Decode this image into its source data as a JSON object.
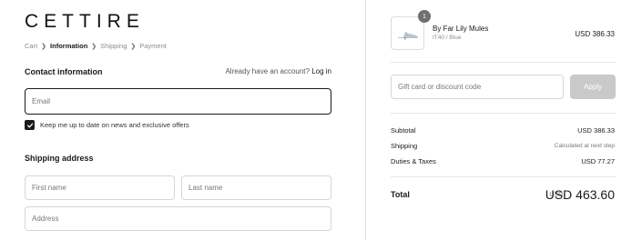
{
  "brand": {
    "logo_text": "CETTIRE"
  },
  "breadcrumb": {
    "items": [
      "Cart",
      "Information",
      "Shipping",
      "Payment"
    ]
  },
  "contact": {
    "title": "Contact information",
    "login_prompt": "Already have an account?",
    "login_link": "Log in",
    "email_placeholder": "Email",
    "newsletter_label": "Keep me up to date on news and exclusive offers",
    "newsletter_checked": true
  },
  "shipping": {
    "title": "Shipping address",
    "first_name_placeholder": "First name",
    "last_name_placeholder": "Last name",
    "address_placeholder": "Address"
  },
  "order": {
    "item": {
      "quantity": "1",
      "name": "By Far Lily Mules",
      "variant": "IT40 / Blue",
      "price": "USD 386.33"
    },
    "discount_placeholder": "Gift card or discount code",
    "apply_label": "Apply",
    "subtotal_label": "Subtotal",
    "subtotal_value": "USD 386.33",
    "shipping_label": "Shipping",
    "shipping_value": "Calculated at next step",
    "duties_label": "Duties & Taxes",
    "duties_value": "USD 77.27",
    "total_label": "Total",
    "total_currency": "USD",
    "total_value": "USD 463.60"
  },
  "colors": {
    "text": "#1a1a1a",
    "muted": "#8d8d8d",
    "border": "#d6d6d6",
    "apply_disabled": "#c9c9c9",
    "badge": "#6f6f6f"
  }
}
